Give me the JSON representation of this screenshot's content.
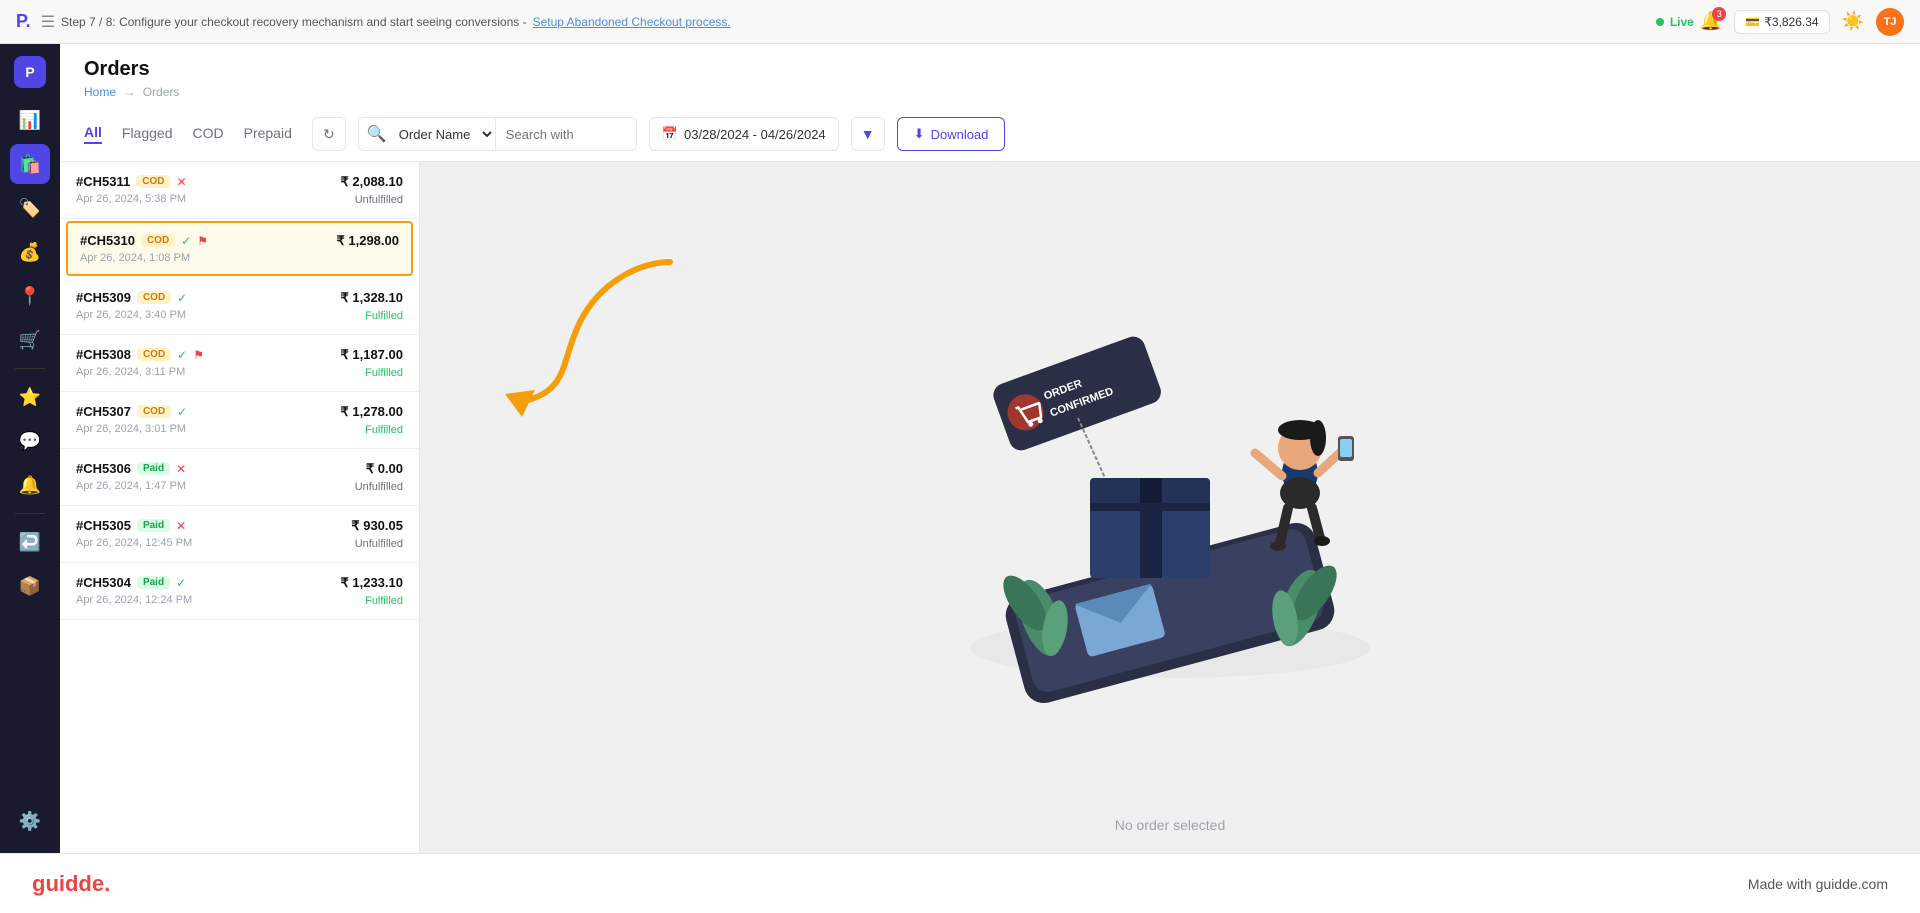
{
  "banner": {
    "step_text": "Step 7 / 8: Configure your checkout recovery mechanism and start seeing conversions - ",
    "setup_link": "Setup Abandoned Checkout process.",
    "live_label": "Live",
    "wallet_amount": "₹3,826.34",
    "notif_count": "3",
    "user_initials": "TJ"
  },
  "sidebar": {
    "items": [
      {
        "icon": "📊",
        "label": "analytics",
        "active": false
      },
      {
        "icon": "🛍️",
        "label": "orders",
        "active": true
      },
      {
        "icon": "🏷️",
        "label": "discounts",
        "active": false
      },
      {
        "icon": "💰",
        "label": "payments",
        "active": false
      },
      {
        "icon": "📍",
        "label": "locations",
        "active": false
      },
      {
        "icon": "🛒",
        "label": "cart",
        "active": false
      },
      {
        "icon": "⭐",
        "label": "reviews",
        "active": false
      },
      {
        "icon": "💬",
        "label": "chat",
        "active": false
      },
      {
        "icon": "🔔",
        "label": "notifications",
        "active": false
      },
      {
        "icon": "↩️",
        "label": "returns",
        "active": false
      },
      {
        "icon": "📦",
        "label": "inventory",
        "active": false
      },
      {
        "icon": "⚙️",
        "label": "settings",
        "active": false
      }
    ]
  },
  "orders": {
    "title": "Orders",
    "breadcrumb_home": "Home",
    "breadcrumb_sep": "→",
    "breadcrumb_current": "Orders",
    "tabs": [
      {
        "label": "All",
        "active": true
      },
      {
        "label": "Flagged",
        "active": false
      },
      {
        "label": "COD",
        "active": false
      },
      {
        "label": "Prepaid",
        "active": false
      }
    ],
    "search_placeholder": "Search with",
    "search_option": "Order Name",
    "date_range": "03/28/2024 - 04/26/2024",
    "download_label": "Download",
    "filter_label": "Filter",
    "no_order_selected": "No order selected",
    "rows": [
      {
        "id": "#CH5311",
        "badge": "COD",
        "badge_type": "cod",
        "has_cancel": true,
        "amount": "₹ 2,088.10",
        "date": "Apr 26, 2024, 5:38 PM",
        "status": "Unfulfilled",
        "status_type": "unfulfilled",
        "selected": false
      },
      {
        "id": "#CH5310",
        "badge": "COD",
        "badge_type": "cod",
        "has_check": true,
        "has_flag": true,
        "amount": "₹ 1,298.00",
        "date": "Apr 26, 2024, 1:08 PM",
        "status": "",
        "status_type": "",
        "selected": true
      },
      {
        "id": "#CH5309",
        "badge": "COD",
        "badge_type": "cod",
        "has_check": true,
        "amount": "₹ 1,328.10",
        "date": "Apr 26, 2024, 3:40 PM",
        "status": "Fulfilled",
        "status_type": "fulfilled",
        "selected": false
      },
      {
        "id": "#CH5308",
        "badge": "COD",
        "badge_type": "cod",
        "has_check": true,
        "has_flag": true,
        "amount": "₹ 1,187.00",
        "date": "Apr 26, 2024, 3:11 PM",
        "status": "Fulfilled",
        "status_type": "fulfilled",
        "selected": false
      },
      {
        "id": "#CH5307",
        "badge": "COD",
        "badge_type": "cod",
        "has_check": true,
        "amount": "₹ 1,278.00",
        "date": "Apr 26, 2024, 3:01 PM",
        "status": "Fulfilled",
        "status_type": "fulfilled",
        "selected": false
      },
      {
        "id": "#CH5306",
        "badge": "Paid",
        "badge_type": "paid",
        "has_cancel": true,
        "amount": "₹ 0.00",
        "date": "Apr 26, 2024, 1:47 PM",
        "status": "Unfulfilled",
        "status_type": "unfulfilled",
        "selected": false
      },
      {
        "id": "#CH5305",
        "badge": "Paid",
        "badge_type": "paid",
        "has_cancel": true,
        "amount": "₹ 930.05",
        "date": "Apr 26, 2024, 12:45 PM",
        "status": "Unfulfilled",
        "status_type": "unfulfilled",
        "selected": false
      },
      {
        "id": "#CH5304",
        "badge": "Paid",
        "badge_type": "paid",
        "has_check": true,
        "amount": "₹ 1,233.10",
        "date": "Apr 26, 2024, 12:24 PM",
        "status": "Fulfilled",
        "status_type": "fulfilled",
        "selected": false
      }
    ]
  },
  "footer": {
    "brand": "guidde.",
    "tagline": "Made with guidde.com"
  }
}
